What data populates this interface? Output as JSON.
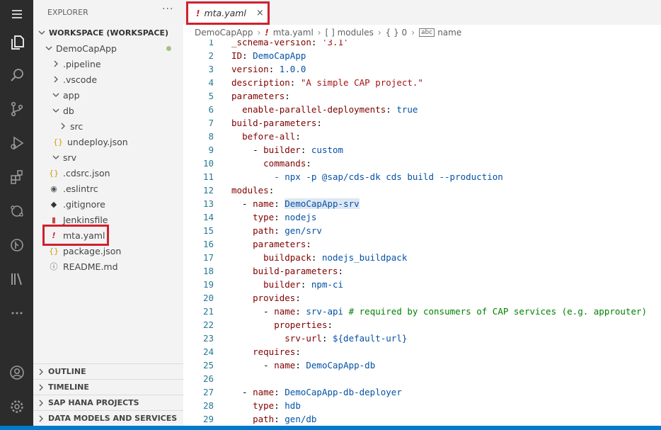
{
  "explorer": {
    "title": "EXPLORER",
    "more": "···",
    "workspace": "WORKSPACE (WORKSPACE)",
    "items": [
      {
        "label": "DemoCapApp"
      },
      {
        "label": ".pipeline"
      },
      {
        "label": ".vscode"
      },
      {
        "label": "app"
      },
      {
        "label": "db"
      },
      {
        "label": "src"
      },
      {
        "label": "undeploy.json"
      },
      {
        "label": "srv"
      },
      {
        "label": ".cdsrc.json"
      },
      {
        "label": ".eslintrc"
      },
      {
        "label": ".gitignore"
      },
      {
        "label": "Jenkinsfile"
      },
      {
        "label": "mta.yaml"
      },
      {
        "label": "package.json"
      },
      {
        "label": "README.md"
      }
    ],
    "sections": [
      "OUTLINE",
      "TIMELINE",
      "SAP HANA PROJECTS",
      "DATA MODELS AND SERVICES"
    ]
  },
  "editor": {
    "tab": {
      "label": "mta.yaml",
      "close": "×",
      "icon": "!"
    },
    "breadcrumb": [
      "DemoCapApp",
      "mta.yaml",
      "[ ] modules",
      "{ } 0",
      "name"
    ],
    "lines": [
      {
        "n": "1",
        "t": "_schema-version: '3.1'"
      },
      {
        "n": "2",
        "t": "ID: DemoCapApp"
      },
      {
        "n": "3",
        "t": "version: 1.0.0"
      },
      {
        "n": "4",
        "t": "description: \"A simple CAP project.\""
      },
      {
        "n": "5",
        "t": "parameters:"
      },
      {
        "n": "6",
        "t": "  enable-parallel-deployments: true"
      },
      {
        "n": "7",
        "t": "build-parameters:"
      },
      {
        "n": "8",
        "t": "  before-all:"
      },
      {
        "n": "9",
        "t": "    - builder: custom"
      },
      {
        "n": "10",
        "t": "      commands:"
      },
      {
        "n": "11",
        "t": "        - npx -p @sap/cds-dk cds build --production"
      },
      {
        "n": "12",
        "t": "modules:"
      },
      {
        "n": "13",
        "t": "  - name: DemoCapApp-srv"
      },
      {
        "n": "14",
        "t": "    type: nodejs"
      },
      {
        "n": "15",
        "t": "    path: gen/srv"
      },
      {
        "n": "16",
        "t": "    parameters:"
      },
      {
        "n": "17",
        "t": "      buildpack: nodejs_buildpack"
      },
      {
        "n": "18",
        "t": "    build-parameters:"
      },
      {
        "n": "19",
        "t": "      builder: npm-ci"
      },
      {
        "n": "20",
        "t": "    provides:"
      },
      {
        "n": "21",
        "t": "      - name: srv-api # required by consumers of CAP services (e.g. approuter)"
      },
      {
        "n": "22",
        "t": "        properties:"
      },
      {
        "n": "23",
        "t": "          srv-url: ${default-url}"
      },
      {
        "n": "24",
        "t": "    requires:"
      },
      {
        "n": "25",
        "t": "      - name: DemoCapApp-db"
      },
      {
        "n": "26",
        "t": ""
      },
      {
        "n": "27",
        "t": "  - name: DemoCapApp-db-deployer"
      },
      {
        "n": "28",
        "t": "    type: hdb"
      },
      {
        "n": "29",
        "t": "    path: gen/db"
      }
    ]
  },
  "icons": [
    "menu-icon",
    "files-icon",
    "search-icon",
    "source-control-icon",
    "run-debug-icon",
    "extensions-icon",
    "remote-explorer-icon",
    "git-graph-icon",
    "library-icon",
    "more-icon",
    "account-icon",
    "settings-gear-icon"
  ],
  "colors": {
    "highlight": "#d0202e",
    "activity_bar": "#2c2c2c",
    "sidebar": "#f3f3f3"
  }
}
